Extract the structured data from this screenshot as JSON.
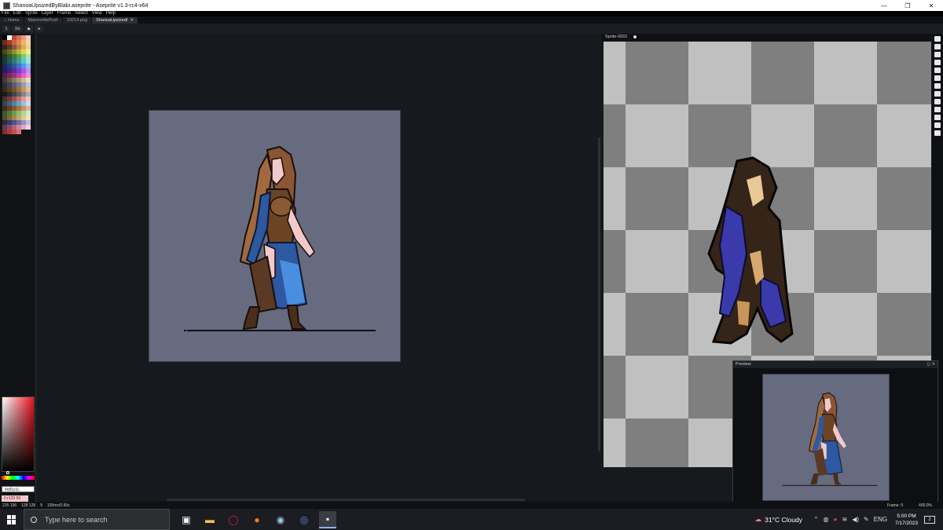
{
  "window": {
    "title": "ShanoaUpsizedByBlabi.aseprite - Aseprite v1.3-rc4-x64",
    "minimize": "—",
    "maximize": "❐",
    "close": "✕"
  },
  "menu": [
    "File",
    "Edit",
    "Sprite",
    "Layer",
    "Frame",
    "Select",
    "View",
    "Help"
  ],
  "tabs": [
    {
      "label": "Home",
      "icon": "home-icon"
    },
    {
      "label": "MarionettePush"
    },
    {
      "label": "19214.png"
    },
    {
      "label": "ShanoaUpsizedI",
      "active": true
    }
  ],
  "context_bar": [
    "1",
    "1/x",
    "◆",
    "●"
  ],
  "palette": {
    "colors": [
      "#000000",
      "#ffffff",
      "#c24a3d",
      "#d4705a",
      "#e89a7a",
      "#f2c9cb",
      "#7a2a1f",
      "#a33c2a",
      "#d25f3c",
      "#e6884c",
      "#f0b36a",
      "#f7d99a",
      "#3a2418",
      "#5a3a26",
      "#8a5a34",
      "#b8824a",
      "#d9ad6a",
      "#f0d28e",
      "#4a4a18",
      "#6a6a22",
      "#92922e",
      "#b8b83c",
      "#d8d852",
      "#f2f27a",
      "#1e3a1e",
      "#2e5a2e",
      "#3e7a3e",
      "#58a058",
      "#7ec87e",
      "#aee8ae",
      "#183a3a",
      "#225a5a",
      "#2e7a7a",
      "#3ea0a0",
      "#5ac8c8",
      "#8ee8e8",
      "#1a2a5a",
      "#24407a",
      "#2e58a0",
      "#3e74c8",
      "#5a96e8",
      "#8cbaf2",
      "#2a1a5a",
      "#3e247a",
      "#5a2ea0",
      "#7a3ec8",
      "#9e5ae8",
      "#c28cf2",
      "#5a1a4a",
      "#7a2464",
      "#a02e82",
      "#c83ea0",
      "#e85ac2",
      "#f28cd8",
      "#4a3a2a",
      "#6a5a42",
      "#8a7a5a",
      "#aa9a76",
      "#c8ba96",
      "#e8dabc",
      "#2a2e3a",
      "#3e4456",
      "#565e76",
      "#727c96",
      "#949eb6",
      "#bcc4d6",
      "#3a2a1a",
      "#5a3e22",
      "#7a542e",
      "#a0723e",
      "#c8965a",
      "#e8be86",
      "#1a1a1a",
      "#2e2e2e",
      "#464646",
      "#626262",
      "#848484",
      "#aaaaaa",
      "#5a2a2a",
      "#7a3a3a",
      "#a05050",
      "#c87070",
      "#e09898",
      "#f2c4c4",
      "#2a4a5a",
      "#3a647a",
      "#4e84a0",
      "#6aa4c2",
      "#92c4de",
      "#bee0f0",
      "#4a2a1a",
      "#6a3e22",
      "#8a5634",
      "#aa724a",
      "#c89268",
      "#e0b48c",
      "#3a5a2a",
      "#4e7a3a",
      "#68a04e",
      "#88c06a",
      "#aed890",
      "#d0ecbc",
      "#5a4a2a",
      "#7a6a3a",
      "#a08a4e",
      "#c4aa6a",
      "#e0c890",
      "#f2e2b8",
      "#2a2a4a",
      "#3a3a6a",
      "#50508a",
      "#6e6eaa",
      "#9494c8",
      "#bcbce2",
      "#6a3a4a",
      "#8a4e62",
      "#aa687e",
      "#c8889e",
      "#e0aabc",
      "#f2d0dc",
      "#8a2a2a",
      "#aa3a3a",
      "#c84e4e",
      "#e06e6e",
      "",
      ""
    ]
  },
  "color_picker": {
    "hex_value": "#c81c1c",
    "fg_color_label": "0 r123 55"
  },
  "editor": {
    "sprite_label": "Sprite-0001",
    "canvas_color": "#666b80"
  },
  "preview": {
    "title": "Preview",
    "ctrls": [
      "◻",
      "✕"
    ]
  },
  "status": {
    "pos": "215 136",
    "size": "128 128",
    "frame_index": "9",
    "duration": "100ms/0.90s",
    "frame_label": "Frame:",
    "frame_value": "9",
    "zoom": "400.0%"
  },
  "taskbar": {
    "search_placeholder": "Type here to search",
    "apps": [
      "task-view-icon",
      "file-explorer-icon",
      "opera-icon",
      "firefox-icon",
      "steam-icon",
      "chromium-icon",
      "aseprite-icon"
    ],
    "weather": "31°C  Cloudy",
    "lang": "ENG",
    "time": "5:00 PM",
    "date": "7/17/2023",
    "notifications": "2"
  }
}
